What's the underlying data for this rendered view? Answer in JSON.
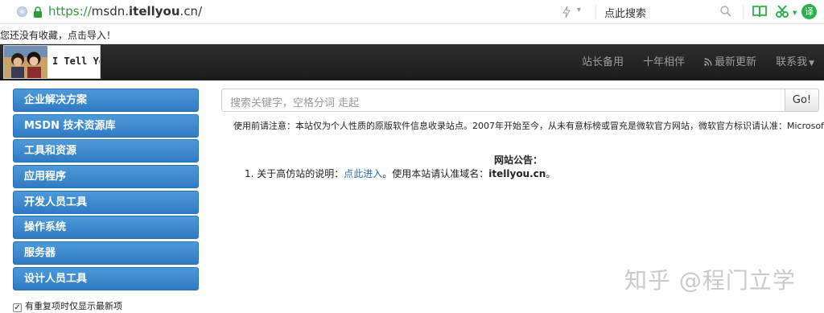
{
  "browser": {
    "url_protocol": "https://",
    "url_host_prefix": "msdn.",
    "url_host_bold": "itellyou",
    "url_host_suffix": ".cn/",
    "search_text": "点此搜索",
    "profile_badge": "译",
    "accent_color": "#2ab14b"
  },
  "bookmarks": {
    "message": "您还没有收藏，点击导入！"
  },
  "site": {
    "logo_text": "I Tell You",
    "nav": [
      {
        "label": "站长备用"
      },
      {
        "label": "十年相伴"
      },
      {
        "label": "最新更新",
        "icon": "rss-icon"
      },
      {
        "label": "联系我",
        "icon": "caret-down-icon"
      }
    ]
  },
  "sidebar": {
    "items": [
      {
        "label": "企业解决方案"
      },
      {
        "label": "MSDN 技术资源库"
      },
      {
        "label": "工具和资源"
      },
      {
        "label": "应用程序"
      },
      {
        "label": "开发人员工具"
      },
      {
        "label": "操作系统"
      },
      {
        "label": "服务器"
      },
      {
        "label": "设计人员工具"
      }
    ],
    "checkbox_label": "有重复项时仅显示最新项",
    "checkbox_checked": true,
    "button_color": "#3a87cc"
  },
  "main": {
    "search_placeholder": "搜索关键字，空格分词 走起",
    "go_label": "Go!",
    "notice": "使用前请注意：本站仅为个人性质的原版软件信息收录站点。2007年开始至今，从未有意标榜或冒充是微软官方网站，微软官方标识请认准：Microsoft。",
    "announcement_title": "网站公告：",
    "announcement": {
      "prefix": "1. 关于高仿站的说明：",
      "link": "点此进入",
      "middle": "。使用本站请认准域名：",
      "domain": "itellyou.cn",
      "suffix": "。"
    }
  },
  "watermark": "知乎 @程门立学"
}
